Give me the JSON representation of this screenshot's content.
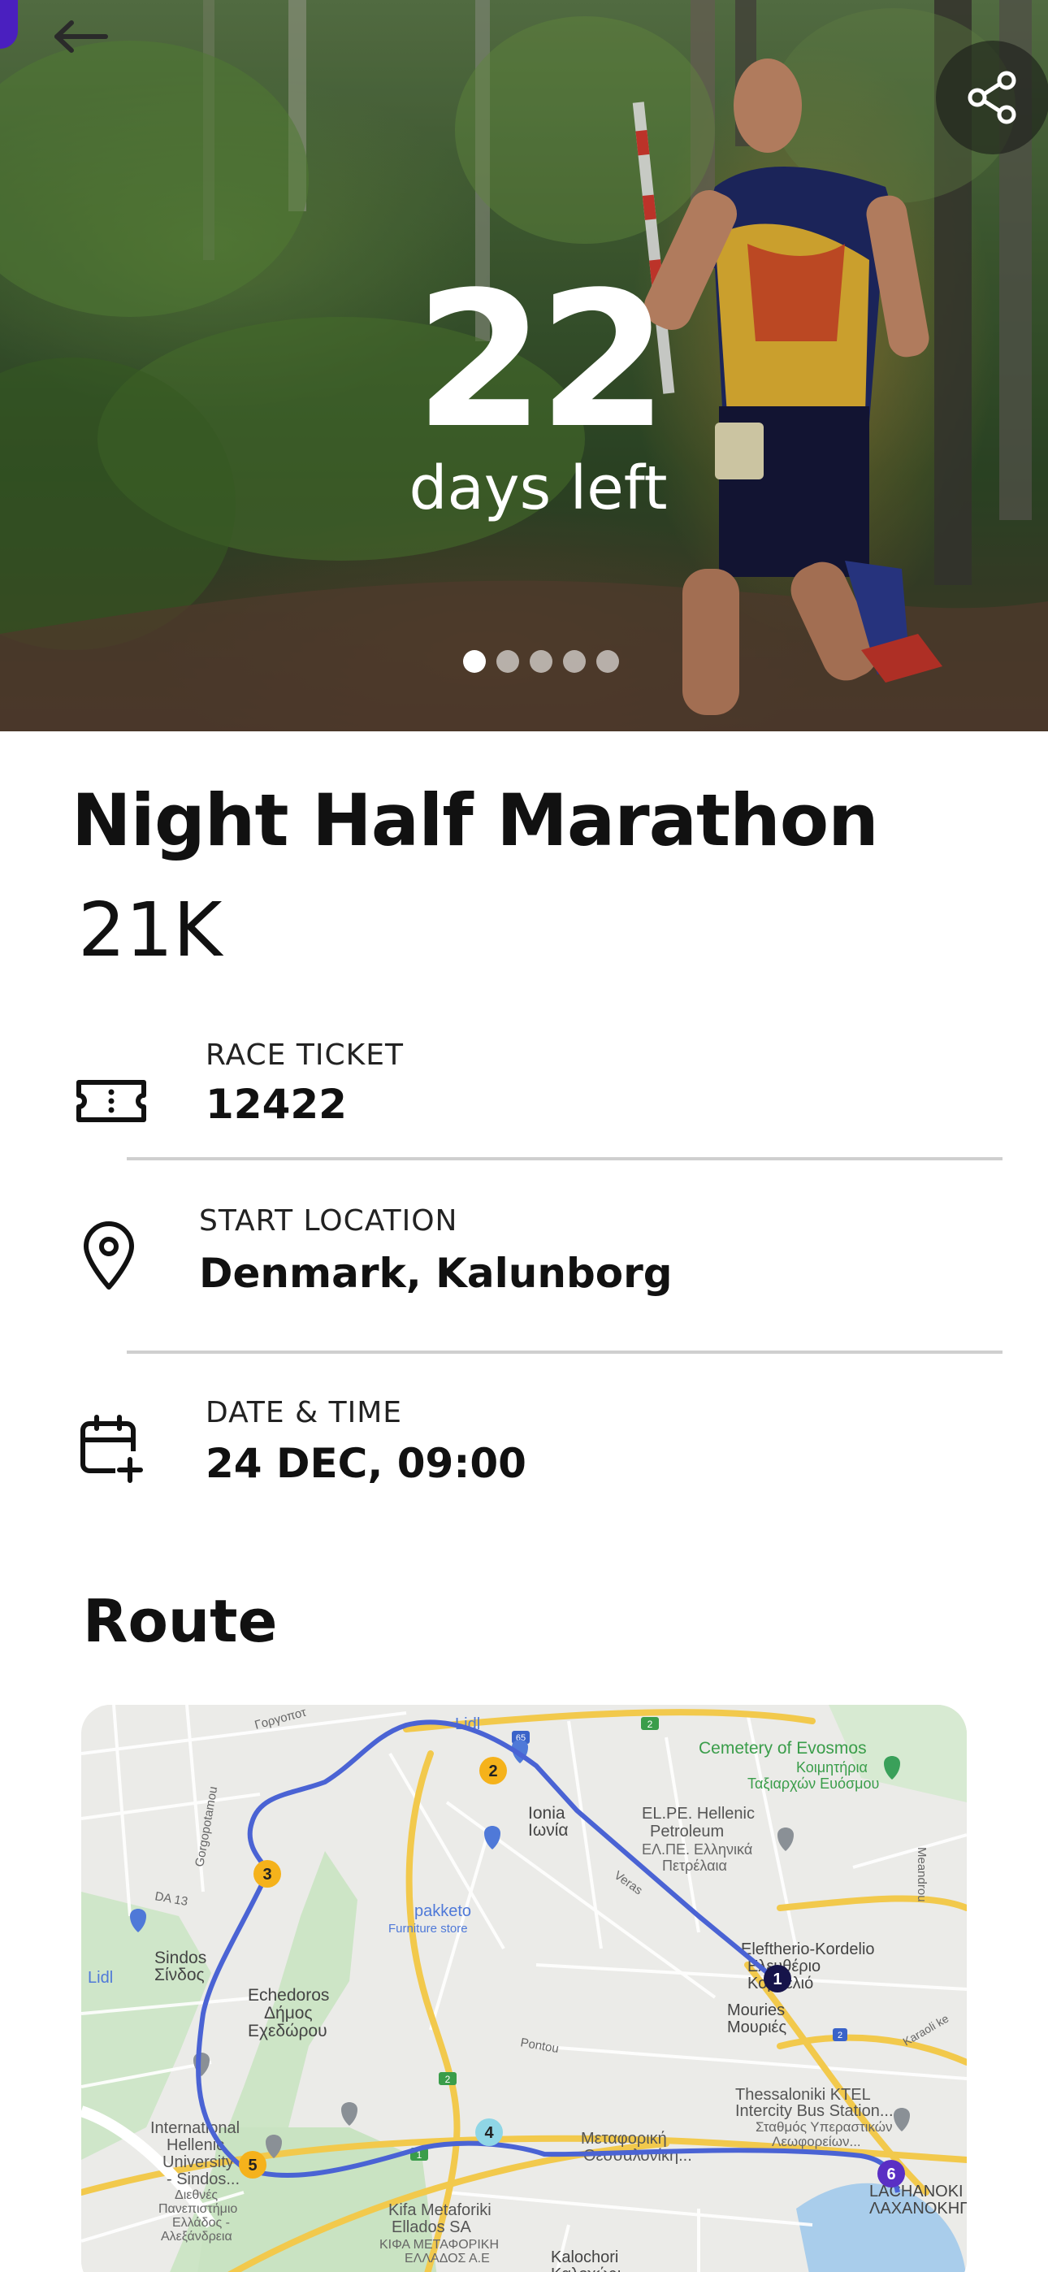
{
  "hero": {
    "countdown_number": "22",
    "countdown_label": "days left",
    "carousel": {
      "count": 5,
      "active_index": 0
    }
  },
  "race": {
    "title": "Night Half Marathon",
    "distance": "21K"
  },
  "details": {
    "ticket": {
      "label": "RACE TICKET",
      "value": "12422"
    },
    "location": {
      "label": "START LOCATION",
      "value": "Denmark, Kalunborg"
    },
    "datetime": {
      "label": "DATE & TIME",
      "value": "24 DEC, 09:00"
    }
  },
  "route": {
    "title": "Route",
    "map_labels": {
      "cemetery": "Cemetery of Evosmos",
      "cemetery_gr1": "Κοιμητήρια",
      "cemetery_gr2": "Ταξιαρχών Ευόσμου",
      "elpe1": "EL.PE. Hellenic",
      "elpe2": "Petroleum",
      "elpe3": "ΕΛ.ΠΕ. Ελληνικά",
      "elpe4": "Πετρέλαια",
      "ionia": "Ionia",
      "ionia_gr": "Ιωνία",
      "pakketo": "pakketo",
      "pakketo_sub": "Furniture store",
      "eleftherio1": "Eleftherio-Kordelio",
      "eleftherio2": "Ελευθέριο",
      "eleftherio3": "Κορδελιό",
      "mouries": "Mouries",
      "mouries_gr": "Μουριές",
      "sindos": "Sindos",
      "sindos_gr": "Σίνδος",
      "echedoros1": "Echedoros",
      "echedoros2": "Δήμος",
      "echedoros3": "Εχεδώρου",
      "lidl": "Lidl",
      "ktel1": "Thessaloniki KTEL",
      "ktel2": "Intercity Bus Station...",
      "ktel3": "Σταθμός Υπεραστικών",
      "ktel4": "Λεωφορείων...",
      "metafor1": "Μεταφορική",
      "metafor2": "Θεσσαλονίκη...",
      "kifa1": "Kifa Metaforiki",
      "kifa2": "Ellados SA",
      "kifa3": "ΚΙΦΑ ΜΕΤΑΦΟΡΙΚΗ",
      "kifa4": "ΕΛΛΑΔΟΣ Α.Ε",
      "kalochori1": "Kalochori",
      "kalochori2": "Καλοχώρι",
      "intl1": "International",
      "intl2": "Hellenic",
      "intl3": "University",
      "intl4": "- Sindos...",
      "intl5": "Διεθνές",
      "intl6": "Πανεπιστήμιο",
      "intl7": "Ελλάδος -",
      "intl8": "Αλεξάνδρεια",
      "lachanokipoi1": "LACHANOKI",
      "lachanokipoi2": "ΛΑΧΑΝΟΚΗΠ",
      "meandrou": "Meandrou",
      "pontou": "Pontou",
      "veras": "Veras",
      "gorgopotamou": "Gorgopotamou",
      "da13": "DA 13",
      "karaoli": "Karaoli ke",
      "gorgon": "Γοργοποτ",
      "road2": "2",
      "road65": "65",
      "road1": "1"
    },
    "checkpoints": [
      "1",
      "2",
      "3",
      "4",
      "5",
      "6"
    ]
  },
  "colors": {
    "accent": "#4a1fbf",
    "route_line": "#4a63d4",
    "checkpoint_yellow": "#f5b21b",
    "checkpoint_navy": "#16144a",
    "checkpoint_light": "#8fd6e6",
    "checkpoint_purple": "#5a2fc4",
    "divider": "#cfcfcf"
  },
  "icons": {
    "back": "arrow-left-icon",
    "share": "share-icon",
    "ticket": "ticket-icon",
    "location": "map-pin-icon",
    "calendar": "calendar-plus-icon"
  }
}
